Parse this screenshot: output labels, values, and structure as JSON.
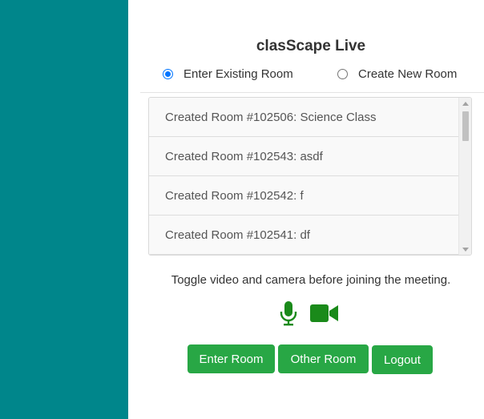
{
  "colors": {
    "sidebar": "#00868b",
    "accent_green": "#28a745",
    "icon_green": "#1a8a1a",
    "radio_blue": "#0075ff"
  },
  "header": {
    "title": "clasScape Live"
  },
  "room_mode": {
    "options": [
      {
        "label": "Enter Existing Room",
        "checked": true
      },
      {
        "label": "Create New Room",
        "checked": false
      }
    ]
  },
  "rooms": {
    "items": [
      {
        "label": "Created Room #102506: Science Class"
      },
      {
        "label": "Created Room #102543: asdf"
      },
      {
        "label": "Created Room #102542: f"
      },
      {
        "label": "Created Room #102541: df"
      }
    ]
  },
  "media": {
    "hint": "Toggle video and camera before joining the meeting.",
    "icons": [
      "microphone-icon",
      "video-camera-icon"
    ]
  },
  "actions": {
    "enter_label": "Enter Room",
    "other_label": "Other Room",
    "logout_label": "Logout"
  }
}
